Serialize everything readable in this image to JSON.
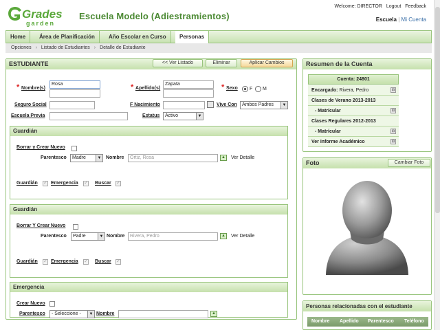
{
  "header": {
    "logo_top": "Grades",
    "logo_bottom": "garden",
    "school": "Escuela Modelo (Adiestramientos)",
    "welcome": "Welcome: DIRECTOR",
    "logout": "Logout",
    "feedback": "Feedback",
    "school_link": "Escuela",
    "separator": "|",
    "my_account": "Mi Cuenta"
  },
  "nav": {
    "tabs": [
      "Home",
      "Área de Planificación",
      "Año Escolar en Curso",
      "Personas"
    ],
    "active": "Personas"
  },
  "breadcrumb": [
    "Opciones",
    "Listado de Estudiantes",
    "Detalle de Estudiante"
  ],
  "student": {
    "title": "ESTUDIANTE",
    "buttons": {
      "list": "<< Ver Listado",
      "delete": "Eliminar",
      "apply": "Aplicar Cambios"
    },
    "labels": {
      "name": "Nombre(s)",
      "last": "Apellido(s)",
      "sex": "Sexo",
      "ssn": "Seguro Social",
      "birth": "F Nacimiento",
      "lives": "Vive Con",
      "prev": "Escuela Previa",
      "status": "Estatus",
      "sex_f": "F",
      "sex_m": "M"
    },
    "values": {
      "name": "Rosa",
      "last": "Zapata",
      "lives": "Ambos Padres",
      "status": "Activo"
    }
  },
  "guardian1": {
    "title": "Guardián",
    "delete_create": "Borrar y Crear Nuevo",
    "relation_label": "Parentesco",
    "relation": "Madre",
    "name_label": "Nombre",
    "name": "Ortiz, Rosa",
    "detail": "Ver Detalle",
    "chk_guardian": "Guardián",
    "chk_emergency": "Emergencia",
    "chk_search": "Buscar"
  },
  "guardian2": {
    "title": "Guardián",
    "delete_create": "Borrar Y Crear Nuevo",
    "relation_label": "Parentesco",
    "relation": "Padre",
    "name_label": "Nombre",
    "name": "Rivera, Pedro",
    "detail": "Ver Detalle",
    "chk_guardian": "Guardián",
    "chk_emergency": "Emergencia",
    "chk_search": "Buscar"
  },
  "emergency": {
    "title": "Emergencia",
    "create": "Crear Nuevo",
    "relation_label": "Parentesco",
    "relation": "- Seleccione -",
    "name_label": "Nombre"
  },
  "account": {
    "title": "Resumen de la Cuenta",
    "account": "Cuenta: 24801",
    "rows": [
      {
        "label": "Encargado:",
        "value": "Rivera, Pedro",
        "icon": true
      },
      {
        "label": "Clases de Verano 2013-2013",
        "value": "",
        "icon": false
      },
      {
        "label": "- Matrícular",
        "value": "",
        "icon": true,
        "indent": true
      },
      {
        "label": "Clases Regulares 2012-2013",
        "value": "",
        "icon": false
      },
      {
        "label": "- Matrícular",
        "value": "",
        "icon": true,
        "indent": true
      },
      {
        "label": "Ver Informe Académico",
        "value": "",
        "icon": true
      }
    ]
  },
  "photo": {
    "title": "Foto",
    "button": "Cambiar Foto"
  },
  "related": {
    "title": "Personas relacionadas con el estudiante",
    "cols": [
      "Nombre",
      "Apellido",
      "Parentesco",
      "Teléfono"
    ]
  },
  "colors": {
    "accent": "#4c8a34",
    "panel_border": "#98c47c",
    "required": "#dd2222"
  }
}
